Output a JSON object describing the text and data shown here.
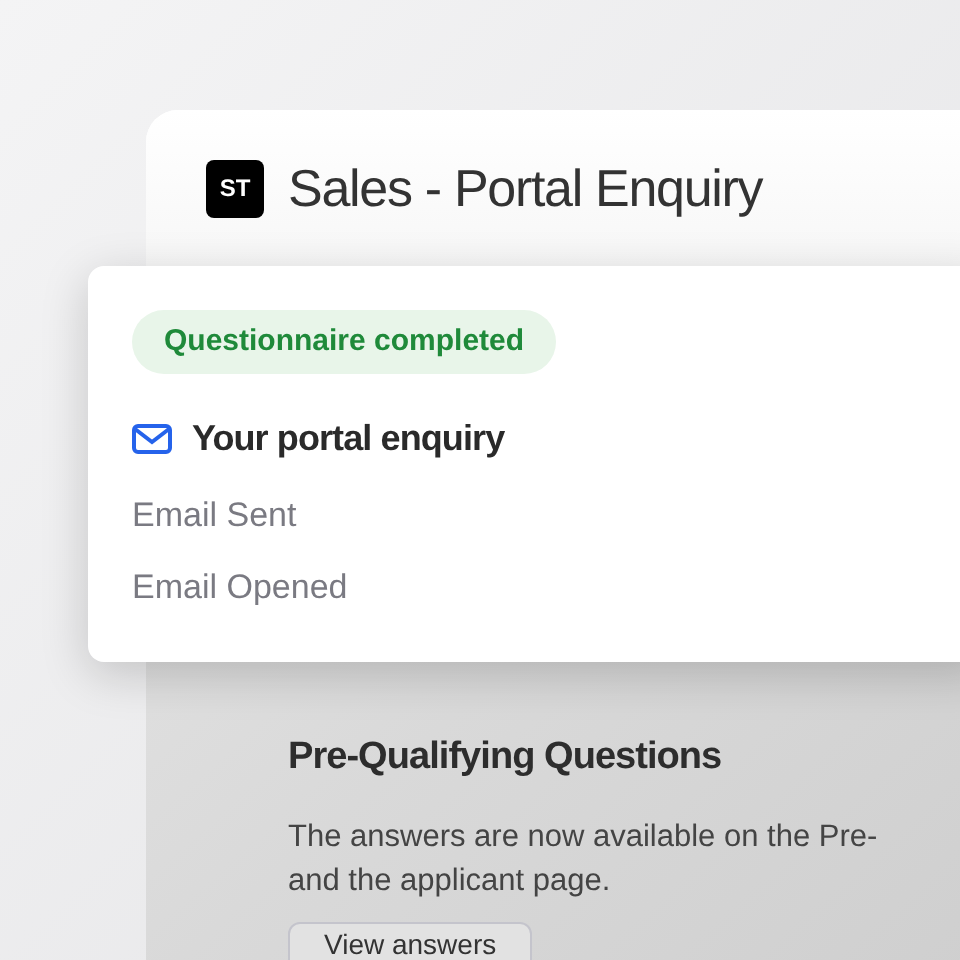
{
  "header": {
    "logo": "ST",
    "title": "Sales - Portal Enquiry"
  },
  "popup": {
    "status_badge": "Questionnaire completed",
    "heading": "Your portal enquiry",
    "events": [
      "Email Sent",
      "Email Opened"
    ]
  },
  "section": {
    "title": "Pre-Qualifying Questions",
    "body_lines": [
      "The answers are now available on the Pre-",
      "and the applicant page."
    ],
    "button": "View answers"
  }
}
